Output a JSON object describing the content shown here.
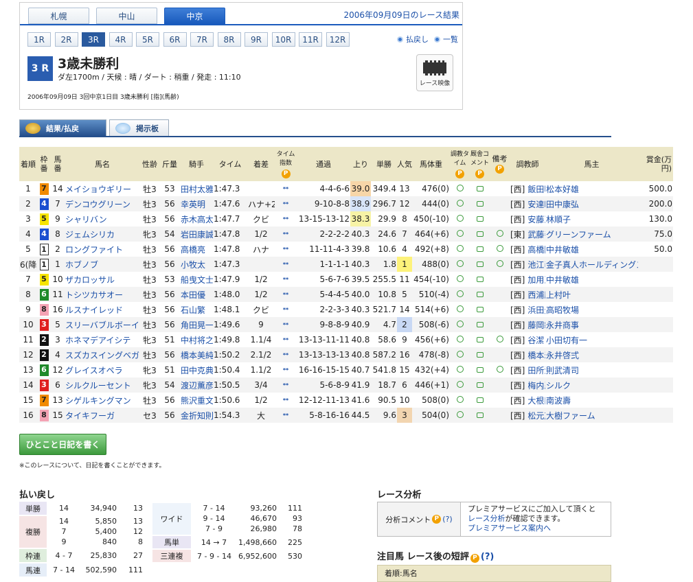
{
  "header": {
    "tabs": [
      "札幌",
      "中山",
      "中京"
    ],
    "active_tab": 2,
    "date_link": "2006年09月09日のレース結果",
    "races": [
      "1R",
      "2R",
      "3R",
      "4R",
      "5R",
      "6R",
      "7R",
      "8R",
      "9R",
      "10R",
      "11R",
      "12R"
    ],
    "active_race": 2,
    "links": [
      "払戻し",
      "一覧"
    ],
    "race_badge": "3 R",
    "race_title": "3歳未勝利",
    "conditions": "ダ左1700m / 天候 : 晴 / ダート : 稍重 / 発走 : 11:10",
    "meta": "2006年09月09日 3回中京1日目 3歳未勝利 [指](馬齢)",
    "video_label": "レース映像"
  },
  "subtabs": [
    "結果/払戻",
    "掲示板"
  ],
  "table": {
    "headers": [
      "着順",
      "枠番",
      "馬番",
      "馬名",
      "性齢",
      "斤量",
      "騎手",
      "タイム",
      "着差",
      "タイム指数",
      "通過",
      "上り",
      "単勝",
      "人気",
      "馬体重",
      "調教タイム",
      "厩舎コメント",
      "備考",
      "調教師",
      "馬主",
      "賞金(万円)"
    ],
    "rows": [
      {
        "pos": "1",
        "waku": "7",
        "ban": "14",
        "name": "メイショウギリー",
        "sa": "牡3",
        "kin": "53",
        "jockey": "田村太雅",
        "time": "1:47.3",
        "diff": "",
        "ti": "**",
        "pass": "4-4-6-6",
        "agari": "39.0",
        "odds": "349.4",
        "ninki": "13",
        "weight": "476(0)",
        "biko": false,
        "loc": "[西]",
        "trainer": "飯田明弘",
        "owner": "松本好雄",
        "prize": "500.0"
      },
      {
        "pos": "2",
        "waku": "4",
        "ban": "7",
        "name": "デンコウグリーン",
        "sa": "牡3",
        "kin": "56",
        "jockey": "幸英明",
        "time": "1:47.6",
        "diff": "ハナ+2",
        "ti": "**",
        "pass": "9-10-8-8",
        "agari": "38.9",
        "odds": "296.7",
        "ninki": "12",
        "weight": "444(0)",
        "biko": false,
        "loc": "[西]",
        "trainer": "安達昭夫",
        "owner": "田中康弘",
        "prize": "200.0"
      },
      {
        "pos": "3",
        "waku": "5",
        "ban": "9",
        "name": "シャリバン",
        "sa": "牡3",
        "kin": "56",
        "jockey": "赤木高太",
        "time": "1:47.7",
        "diff": "クビ",
        "ti": "**",
        "pass": "13-15-13-12",
        "agari": "38.3",
        "odds": "29.9",
        "ninki": "8",
        "weight": "450(-10)",
        "biko": false,
        "loc": "[西]",
        "trainer": "安藤正敏",
        "owner": "林順子",
        "prize": "130.0"
      },
      {
        "pos": "4",
        "waku": "4",
        "ban": "8",
        "name": "ジェムシリカ",
        "sa": "牝3",
        "kin": "54",
        "jockey": "岩田康誠",
        "time": "1:47.8",
        "diff": "1/2",
        "ti": "**",
        "pass": "2-2-2-2",
        "agari": "40.3",
        "odds": "24.6",
        "ninki": "7",
        "weight": "464(+6)",
        "biko": true,
        "loc": "[東]",
        "trainer": "武藤善則",
        "owner": "グリーンファーム",
        "prize": "75.0"
      },
      {
        "pos": "5",
        "waku": "1",
        "ban": "2",
        "name": "ロングファイト",
        "sa": "牡3",
        "kin": "56",
        "jockey": "高橋亮",
        "time": "1:47.8",
        "diff": "ハナ",
        "ti": "**",
        "pass": "11-11-4-3",
        "agari": "39.8",
        "odds": "10.6",
        "ninki": "4",
        "weight": "492(+8)",
        "biko": true,
        "loc": "[西]",
        "trainer": "高橋隆",
        "owner": "中井敏雄",
        "prize": "50.0"
      },
      {
        "pos": "6(降)",
        "waku": "1",
        "ban": "1",
        "name": "ホブノブ",
        "sa": "牡3",
        "kin": "56",
        "jockey": "小牧太",
        "time": "1:47.3",
        "diff": "",
        "ti": "**",
        "pass": "1-1-1-1",
        "agari": "40.3",
        "odds": "1.8",
        "ninki": "1",
        "weight": "488(0)",
        "biko": true,
        "loc": "[西]",
        "trainer": "池江泰寿",
        "owner": "金子真人ホールディングス",
        "prize": ""
      },
      {
        "pos": "7",
        "waku": "5",
        "ban": "10",
        "name": "ザカロッサル",
        "sa": "牡3",
        "kin": "53",
        "jockey": "船曳文士",
        "time": "1:47.9",
        "diff": "1/2",
        "ti": "**",
        "pass": "5-6-7-6",
        "agari": "39.5",
        "odds": "255.5",
        "ninki": "11",
        "weight": "454(-10)",
        "biko": false,
        "loc": "[西]",
        "trainer": "加用正",
        "owner": "中井敏雄",
        "prize": ""
      },
      {
        "pos": "8",
        "waku": "6",
        "ban": "11",
        "name": "トシツカサオー",
        "sa": "牡3",
        "kin": "56",
        "jockey": "本田優",
        "time": "1:48.0",
        "diff": "1/2",
        "ti": "**",
        "pass": "5-4-4-5",
        "agari": "40.0",
        "odds": "10.8",
        "ninki": "5",
        "weight": "510(-4)",
        "biko": false,
        "loc": "[西]",
        "trainer": "西浦勝一",
        "owner": "上村叶",
        "prize": ""
      },
      {
        "pos": "9",
        "waku": "8",
        "ban": "16",
        "name": "ルスナイレッド",
        "sa": "牡3",
        "kin": "56",
        "jockey": "石山繁",
        "time": "1:48.1",
        "diff": "クビ",
        "ti": "**",
        "pass": "2-2-3-3",
        "agari": "40.3",
        "odds": "521.7",
        "ninki": "14",
        "weight": "514(+6)",
        "biko": false,
        "loc": "[西]",
        "trainer": "浜田光正",
        "owner": "高昭牧場",
        "prize": ""
      },
      {
        "pos": "10",
        "waku": "3",
        "ban": "5",
        "name": "スリーバブルボーイ",
        "sa": "牡3",
        "kin": "56",
        "jockey": "角田晃一",
        "time": "1:49.6",
        "diff": "9",
        "ti": "**",
        "pass": "9-8-8-9",
        "agari": "40.9",
        "odds": "4.7",
        "ninki": "2",
        "weight": "508(-6)",
        "biko": false,
        "loc": "[西]",
        "trainer": "藤岡範士",
        "owner": "永井商事",
        "prize": ""
      },
      {
        "pos": "11",
        "waku": "2",
        "ban": "3",
        "name": "ホネマデアイシテ",
        "sa": "牝3",
        "kin": "51",
        "jockey": "中村将之",
        "time": "1:49.8",
        "diff": "1.1/4",
        "ti": "**",
        "pass": "13-13-11-11",
        "agari": "40.8",
        "odds": "58.6",
        "ninki": "9",
        "weight": "456(+6)",
        "biko": true,
        "loc": "[西]",
        "trainer": "谷潔",
        "owner": "小田切有一",
        "prize": ""
      },
      {
        "pos": "12",
        "waku": "2",
        "ban": "4",
        "name": "スズカスイングベガ",
        "sa": "牡3",
        "kin": "56",
        "jockey": "橋本美純",
        "time": "1:50.2",
        "diff": "2.1/2",
        "ti": "**",
        "pass": "13-13-13-13",
        "agari": "40.8",
        "odds": "587.2",
        "ninki": "16",
        "weight": "478(-8)",
        "biko": false,
        "loc": "[西]",
        "trainer": "橋本寿正",
        "owner": "永井啓弍",
        "prize": ""
      },
      {
        "pos": "13",
        "waku": "6",
        "ban": "12",
        "name": "グレイスオペラ",
        "sa": "牝3",
        "kin": "51",
        "jockey": "田中克典",
        "time": "1:50.4",
        "diff": "1.1/2",
        "ti": "**",
        "pass": "16-16-15-15",
        "agari": "40.7",
        "odds": "541.8",
        "ninki": "15",
        "weight": "432(+4)",
        "biko": true,
        "loc": "[西]",
        "trainer": "田所清広",
        "owner": "則武清司",
        "prize": ""
      },
      {
        "pos": "14",
        "waku": "3",
        "ban": "6",
        "name": "シルクルーセント",
        "sa": "牝3",
        "kin": "54",
        "jockey": "渡辺薫彦",
        "time": "1:50.5",
        "diff": "3/4",
        "ti": "**",
        "pass": "5-6-8-9",
        "agari": "41.9",
        "odds": "18.7",
        "ninki": "6",
        "weight": "446(+1)",
        "biko": false,
        "loc": "[西]",
        "trainer": "梅内忍",
        "owner": "シルク",
        "prize": ""
      },
      {
        "pos": "15",
        "waku": "7",
        "ban": "13",
        "name": "シゲルキングマン",
        "sa": "牡3",
        "kin": "56",
        "jockey": "熊沢重文",
        "time": "1:50.6",
        "diff": "1/2",
        "ti": "**",
        "pass": "12-12-11-13",
        "agari": "41.6",
        "odds": "90.5",
        "ninki": "10",
        "weight": "508(0)",
        "biko": false,
        "loc": "[西]",
        "trainer": "大根田裕",
        "owner": "南波壽",
        "prize": ""
      },
      {
        "pos": "16",
        "waku": "8",
        "ban": "15",
        "name": "タイキフーガ",
        "sa": "セ3",
        "kin": "56",
        "jockey": "金折知則",
        "time": "1:54.3",
        "diff": "大",
        "ti": "**",
        "pass": "5-8-16-16",
        "agari": "44.5",
        "odds": "9.6",
        "ninki": "3",
        "weight": "504(0)",
        "biko": false,
        "loc": "[西]",
        "trainer": "松元茂樹",
        "owner": "大樹ファーム",
        "prize": ""
      }
    ]
  },
  "waku_colors": {
    "1": [
      "#ffffff",
      "#222222"
    ],
    "2": [
      "#111111",
      "#ffffff"
    ],
    "3": [
      "#e02020",
      "#ffffff"
    ],
    "4": [
      "#1a4fd0",
      "#ffffff"
    ],
    "5": [
      "#f6e400",
      "#222222"
    ],
    "6": [
      "#1f8a2a",
      "#ffffff"
    ],
    "7": [
      "#f08a00",
      "#222222"
    ],
    "8": [
      "#f4a3b4",
      "#222222"
    ]
  },
  "diary_button": "ひとこと日記を書く",
  "diary_note": "※このレースについて、日記を書くことができます。",
  "payout": {
    "title": "払い戻し",
    "tansho": {
      "label": "単勝",
      "num": "14",
      "amount": "34,940",
      "pop": "13"
    },
    "fukusho": {
      "label": "複勝",
      "nums": [
        "14",
        "7",
        "9"
      ],
      "amounts": [
        "5,850",
        "5,400",
        "840"
      ],
      "pops": [
        "13",
        "12",
        "8"
      ]
    },
    "wakuren": {
      "label": "枠連",
      "num": "4 - 7",
      "amount": "25,830",
      "pop": "27"
    },
    "umaren": {
      "label": "馬連",
      "num": "7 - 14",
      "amount": "502,590",
      "pop": "111"
    },
    "wide": {
      "label": "ワイド",
      "nums": [
        "7 - 14",
        "9 - 14",
        "7 - 9"
      ],
      "amounts": [
        "93,260",
        "46,670",
        "26,980"
      ],
      "pops": [
        "111",
        "93",
        "78"
      ]
    },
    "umatan": {
      "label": "馬単",
      "num": "14 → 7",
      "amount": "1,498,660",
      "pop": "225"
    },
    "sanrenpuku": {
      "label": "三連複",
      "num": "7 - 9 - 14",
      "amount": "6,952,600",
      "pop": "530"
    }
  },
  "analysis": {
    "title": "レース分析",
    "key": "分析コメント",
    "help": "(?)",
    "line1": "プレミアサービスにご加入して頂くと",
    "link1": "レース分析",
    "line2": "が確認できます。",
    "link2": "プレミアサービス案内へ"
  },
  "chumoku": {
    "title": "注目馬 レース後の短評",
    "help": "(?)",
    "header": "着順:馬名"
  },
  "p_mark": "P"
}
